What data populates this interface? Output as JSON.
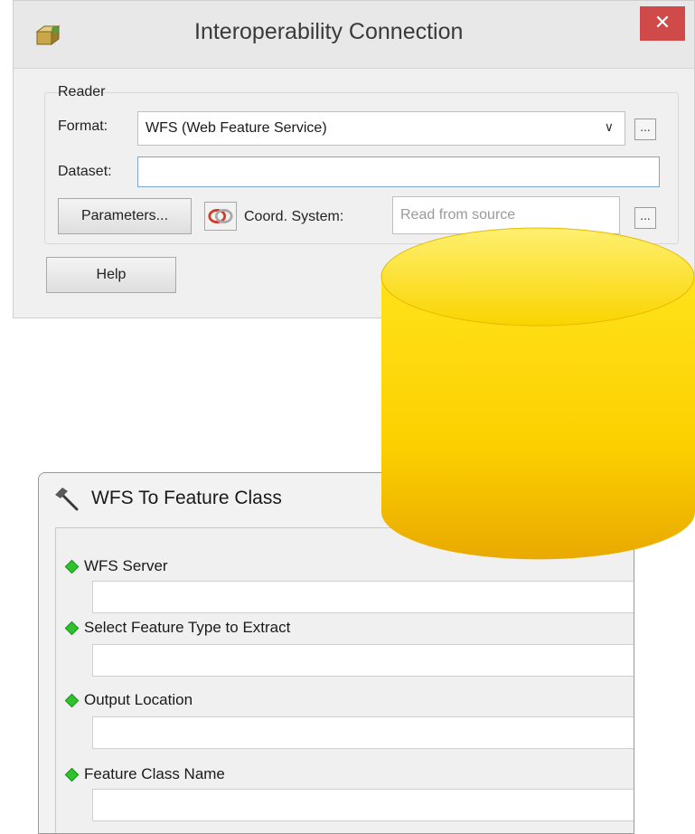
{
  "interop_dialog": {
    "title": "Interoperability Connection",
    "close_glyph": "✕",
    "reader_group_label": "Reader",
    "format_label": "Format:",
    "format_value": "WFS (Web Feature Service)",
    "dataset_label": "Dataset:",
    "dataset_value": "",
    "parameters_button": "Parameters...",
    "coord_system_label": "Coord. System:",
    "coord_system_placeholder": "Read from source",
    "browse_glyph": "...",
    "help_button": "Help"
  },
  "wfs_tool": {
    "title": "WFS To Feature Class",
    "params": [
      {
        "label": "WFS Server",
        "value": ""
      },
      {
        "label": "Select Feature Type to Extract",
        "value": ""
      },
      {
        "label": "Output Location",
        "value": ""
      },
      {
        "label": "Feature Class Name",
        "value": ""
      }
    ]
  },
  "colors": {
    "close_button": "#d04a4a",
    "required_marker": "#2fc22f",
    "database_fill": "#f7c600"
  },
  "icons": [
    "app-icon",
    "close-icon",
    "chevron-down-icon",
    "coordinate-system-icon",
    "hammer-icon",
    "database-icon"
  ]
}
